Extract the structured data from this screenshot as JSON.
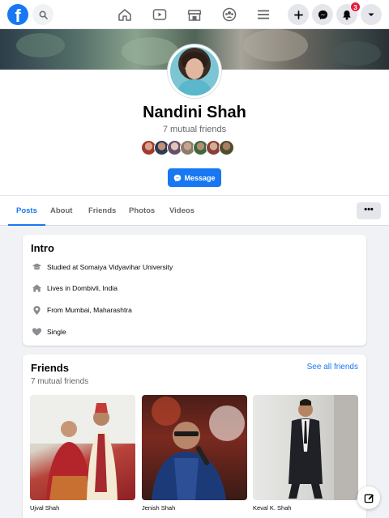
{
  "nav": {
    "brand_letter": "f",
    "icons": [
      "search-icon",
      "home-icon",
      "watch-icon",
      "marketplace-icon",
      "groups-icon",
      "menu-icon"
    ],
    "actions": [
      "create-icon",
      "messenger-icon",
      "notifications-icon",
      "account-caret-icon"
    ],
    "notification_count": "3"
  },
  "profile": {
    "name": "Nandini Shah",
    "mutual_friends": "7 mutual friends",
    "message_label": "Message"
  },
  "tabs": [
    {
      "label": "Posts",
      "active": true
    },
    {
      "label": "About"
    },
    {
      "label": "Friends"
    },
    {
      "label": "Photos"
    },
    {
      "label": "Videos"
    }
  ],
  "more_label": "•••",
  "intro": {
    "title": "Intro",
    "items": [
      {
        "icon": "education-icon",
        "text": "Studied at Somaiya Vidyavihar University"
      },
      {
        "icon": "home-icon",
        "text": "Lives in Dombivli, India"
      },
      {
        "icon": "location-icon",
        "text": "From Mumbai, Maharashtra"
      },
      {
        "icon": "heart-icon",
        "text": "Single"
      }
    ]
  },
  "friends": {
    "title": "Friends",
    "subtitle": "7 mutual friends",
    "see_all": "See all friends",
    "list": [
      {
        "name": "Ujval Shah"
      },
      {
        "name": "Jenish Shah"
      },
      {
        "name": "Keval K. Shah"
      }
    ]
  },
  "colors": {
    "accent": "#1877f2",
    "badge": "#e41e3f",
    "background": "#f0f2f5"
  }
}
